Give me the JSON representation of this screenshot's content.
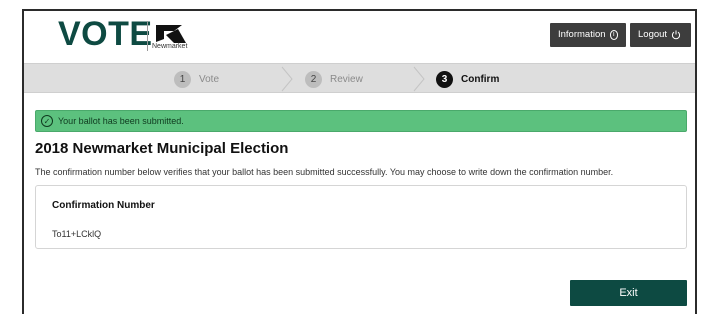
{
  "header": {
    "logo_text": "VOTE",
    "logo_subtext": "Newmarket",
    "info_label": "Information",
    "logout_label": "Logout"
  },
  "stepper": {
    "steps": [
      {
        "number": "1",
        "label": "Vote",
        "active": false
      },
      {
        "number": "2",
        "label": "Review",
        "active": false
      },
      {
        "number": "3",
        "label": "Confirm",
        "active": true
      }
    ]
  },
  "alert": {
    "message": "Your ballot has been submitted."
  },
  "main": {
    "title": "2018 Newmarket Municipal Election",
    "description": "The confirmation number below verifies that your ballot has been submitted successfully. You may choose to write down the confirmation number.",
    "confirmation_label": "Confirmation Number",
    "confirmation_value": "To11+LCklQ"
  },
  "actions": {
    "exit_label": "Exit"
  },
  "colors": {
    "brand": "#0e4a42",
    "success": "#5cc17e",
    "header_button": "#3d3d3d",
    "stepper_bg": "#dedede"
  },
  "icons": {
    "info": "info-circle-icon",
    "logout": "power-icon",
    "alert": "check-circle-icon"
  }
}
